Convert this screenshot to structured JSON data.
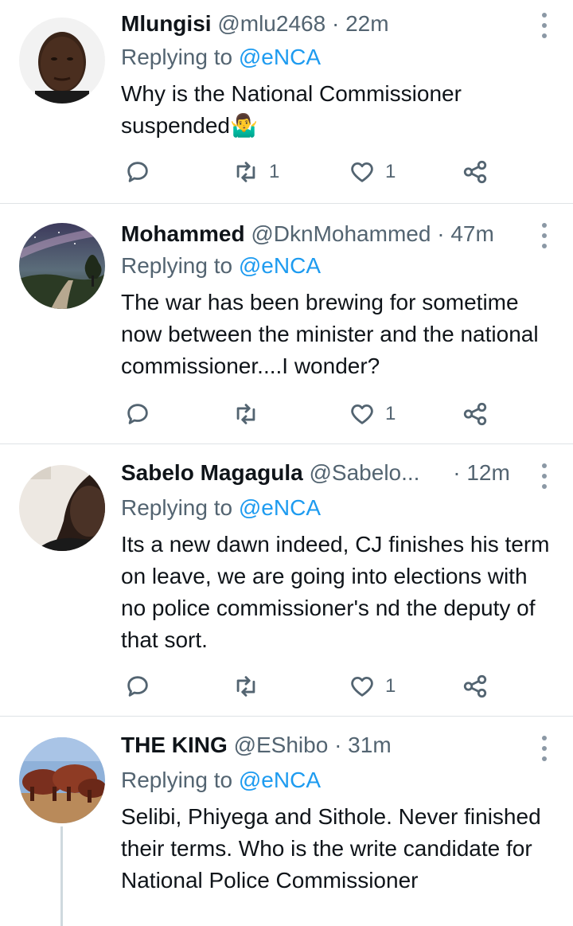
{
  "tweets": [
    {
      "name": "Mlungisi",
      "handle": "@mlu2468",
      "sep": "·",
      "time": "22m",
      "replying_prefix": "Replying to ",
      "replying_to": "@eNCA",
      "text": "Why is the National Commissioner suspended🤷‍♂️",
      "reply_count": "",
      "retweet_count": "1",
      "like_count": "1",
      "avatar": "man-portrait"
    },
    {
      "name": "Mohammed",
      "handle": "@DknMohammed",
      "sep": "·",
      "time": "47m",
      "replying_prefix": "Replying to ",
      "replying_to": "@eNCA",
      "text": "The war has been brewing for sometime now between the minister and the national commissioner....I wonder?",
      "reply_count": "",
      "retweet_count": "",
      "like_count": "1",
      "avatar": "night-sky-landscape"
    },
    {
      "name": "Sabelo Magagula",
      "handle": "@Sabelo...",
      "sep": "·",
      "time": "12m",
      "replying_prefix": "Replying to ",
      "replying_to": "@eNCA",
      "text": "Its a new dawn indeed, CJ finishes his term on leave, we are going into elections with no police commissioner's nd the deputy of that sort.",
      "reply_count": "",
      "retweet_count": "",
      "like_count": "1",
      "avatar": "man-selfie"
    },
    {
      "name": "THE KING",
      "handle": "@EShibo",
      "sep": "·",
      "time": "31m",
      "replying_prefix": "Replying to ",
      "replying_to": "@eNCA",
      "text": "Selibi, Phiyega and Sithole. Never finished their terms. Who is the write candidate for National Police Commissioner",
      "avatar": "cattle-herd"
    }
  ],
  "icons": {
    "reply": "reply-icon",
    "retweet": "retweet-icon",
    "like": "heart-icon",
    "share": "share-icon",
    "more": "more-vertical-icon"
  },
  "colors": {
    "link": "#1d9bf0",
    "secondary_text": "#536471",
    "primary_text": "#0f1419",
    "divider": "#dfe3e6"
  }
}
